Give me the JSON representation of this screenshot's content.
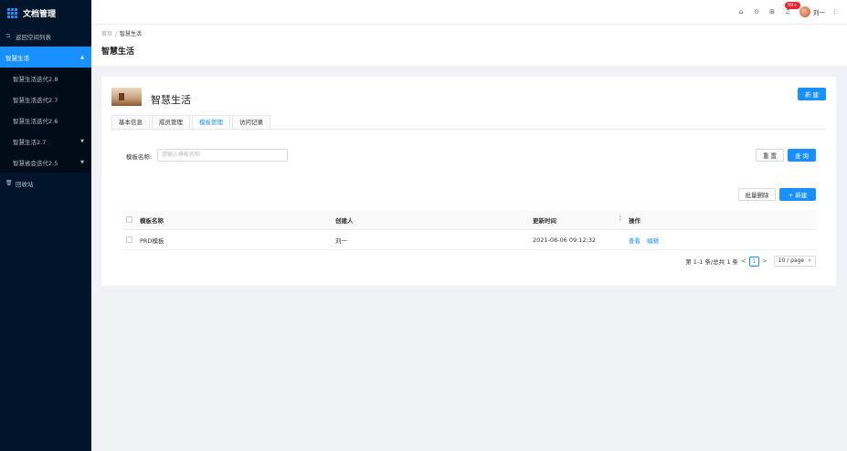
{
  "app": {
    "title": "文档管理"
  },
  "sidebar": {
    "back_label": "返回空间列表",
    "active_group": "智慧生活",
    "items": [
      {
        "label": "智慧生活迭代2.8",
        "has_children": false
      },
      {
        "label": "智慧生活迭代2.7",
        "has_children": false
      },
      {
        "label": "智慧生活迭代2.6",
        "has_children": false
      },
      {
        "label": "智慧生活2.7",
        "has_children": true
      },
      {
        "label": "智慧省会迭代2.5",
        "has_children": true
      }
    ],
    "recycle_label": "回收站"
  },
  "header": {
    "icons": [
      "home-icon",
      "help-icon",
      "grid-icon",
      "bell-icon"
    ],
    "badge": "99+",
    "user_name": "刘一"
  },
  "breadcrumb": {
    "home": "首页",
    "sep": "/",
    "current": "智慧生活"
  },
  "page_title": "智慧生活",
  "doc": {
    "title": "智慧生活",
    "new_button": "新 建"
  },
  "tabs": [
    {
      "label": "基本信息",
      "active": false
    },
    {
      "label": "成员管理",
      "active": false
    },
    {
      "label": "模板管理",
      "active": true
    },
    {
      "label": "访问记录",
      "active": false
    }
  ],
  "filter": {
    "label": "模板名称:",
    "placeholder": "请输入模板名称",
    "reset_button": "重 置",
    "query_button": "查 询"
  },
  "actions": {
    "batch_delete": "批量删除",
    "add": "+ 新建"
  },
  "table": {
    "columns": [
      "模板名称",
      "创建人",
      "更新时间",
      "操作"
    ],
    "rows": [
      {
        "name": "PRD模板",
        "creator": "刘一",
        "updated": "2021-08-06 09:12:32",
        "ops": [
          "查看",
          "编辑"
        ]
      }
    ]
  },
  "pagination": {
    "summary": "第 1-1 条/总共 1 条",
    "prev": "<",
    "current": "1",
    "next": ">",
    "page_size": "10 / page"
  },
  "colors": {
    "primary": "#1890ff",
    "sidebar": "#001529",
    "badge": "#f5222d"
  }
}
